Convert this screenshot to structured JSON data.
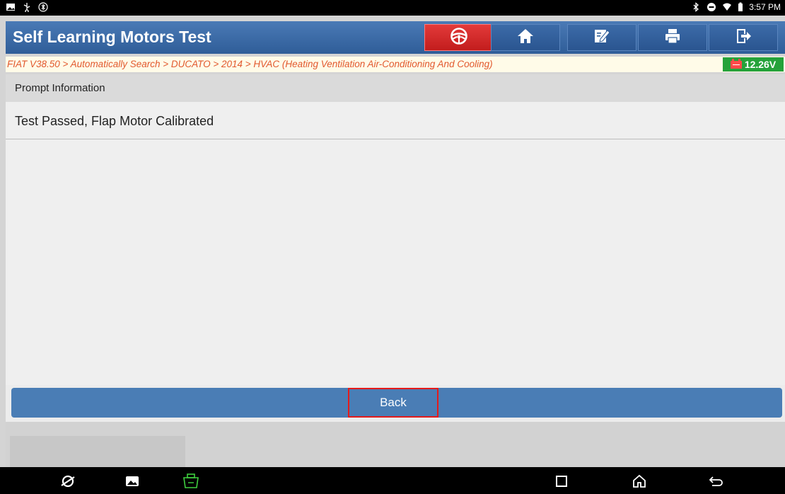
{
  "status_bar": {
    "time": "3:57 PM",
    "left_icons": [
      "gallery-icon",
      "usb-icon",
      "bluetooth-status-icon"
    ],
    "right_icons": [
      "bluetooth-icon",
      "do-not-disturb-icon",
      "wifi-icon",
      "battery-icon"
    ]
  },
  "header": {
    "title": "Self Learning Motors Test",
    "buttons": [
      "steering-wheel-icon",
      "home-icon",
      "edit-report-icon",
      "print-icon",
      "exit-icon"
    ]
  },
  "breadcrumb": {
    "path": "FIAT V38.50 > Automatically Search > DUCATO > 2014 > HVAC (Heating Ventilation Air-Conditioning And Cooling)",
    "voltage": "12.26V"
  },
  "prompt": {
    "header": "Prompt Information",
    "message": "Test Passed, Flap Motor Calibrated"
  },
  "actions": {
    "back_label": "Back"
  },
  "nav_bar": {
    "icons": [
      "browser-icon",
      "gallery-icon",
      "vci-icon",
      "recent-apps-icon",
      "home-nav-icon",
      "back-nav-icon"
    ]
  },
  "colors": {
    "header_blue": "#3a69a6",
    "breadcrumb_text": "#e2592e",
    "voltage_green": "#25a23a",
    "highlight_red": "#e41b1b"
  }
}
